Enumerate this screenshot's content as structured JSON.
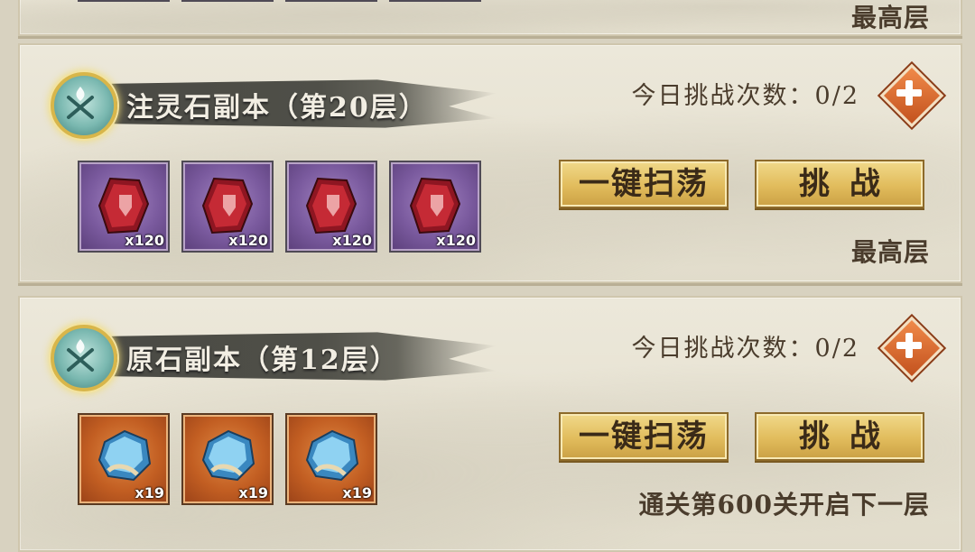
{
  "top_panel": {
    "note": "最高层"
  },
  "dungeons": [
    {
      "title": "注灵石副本（第20层）",
      "challenge_count_label": "今日挑战次数：",
      "challenge_count": "0/2",
      "rewards": [
        {
          "icon": "red-spirit-stone-icon",
          "qty": "x120"
        },
        {
          "icon": "red-spirit-stone-icon",
          "qty": "x120"
        },
        {
          "icon": "red-spirit-stone-icon",
          "qty": "x120"
        },
        {
          "icon": "red-spirit-stone-icon",
          "qty": "x120"
        }
      ],
      "sweep_label": "一键扫荡",
      "challenge_label": "挑战",
      "note": "最高层",
      "frame_color": "#7a5a9e"
    },
    {
      "title": "原石副本（第12层）",
      "challenge_count_label": "今日挑战次数：",
      "challenge_count": "0/2",
      "rewards": [
        {
          "icon": "blue-ore-stone-icon",
          "qty": "x19"
        },
        {
          "icon": "blue-ore-stone-icon",
          "qty": "x19"
        },
        {
          "icon": "blue-ore-stone-icon",
          "qty": "x19"
        }
      ],
      "sweep_label": "一键扫荡",
      "challenge_label": "挑战",
      "note": "通关第600关开启下一层",
      "frame_color": "#c25e22"
    }
  ],
  "colors": {
    "button_gold": "#e1bc5c",
    "plus_orange": "#e06a30",
    "title_brush": "#4a4a44"
  }
}
